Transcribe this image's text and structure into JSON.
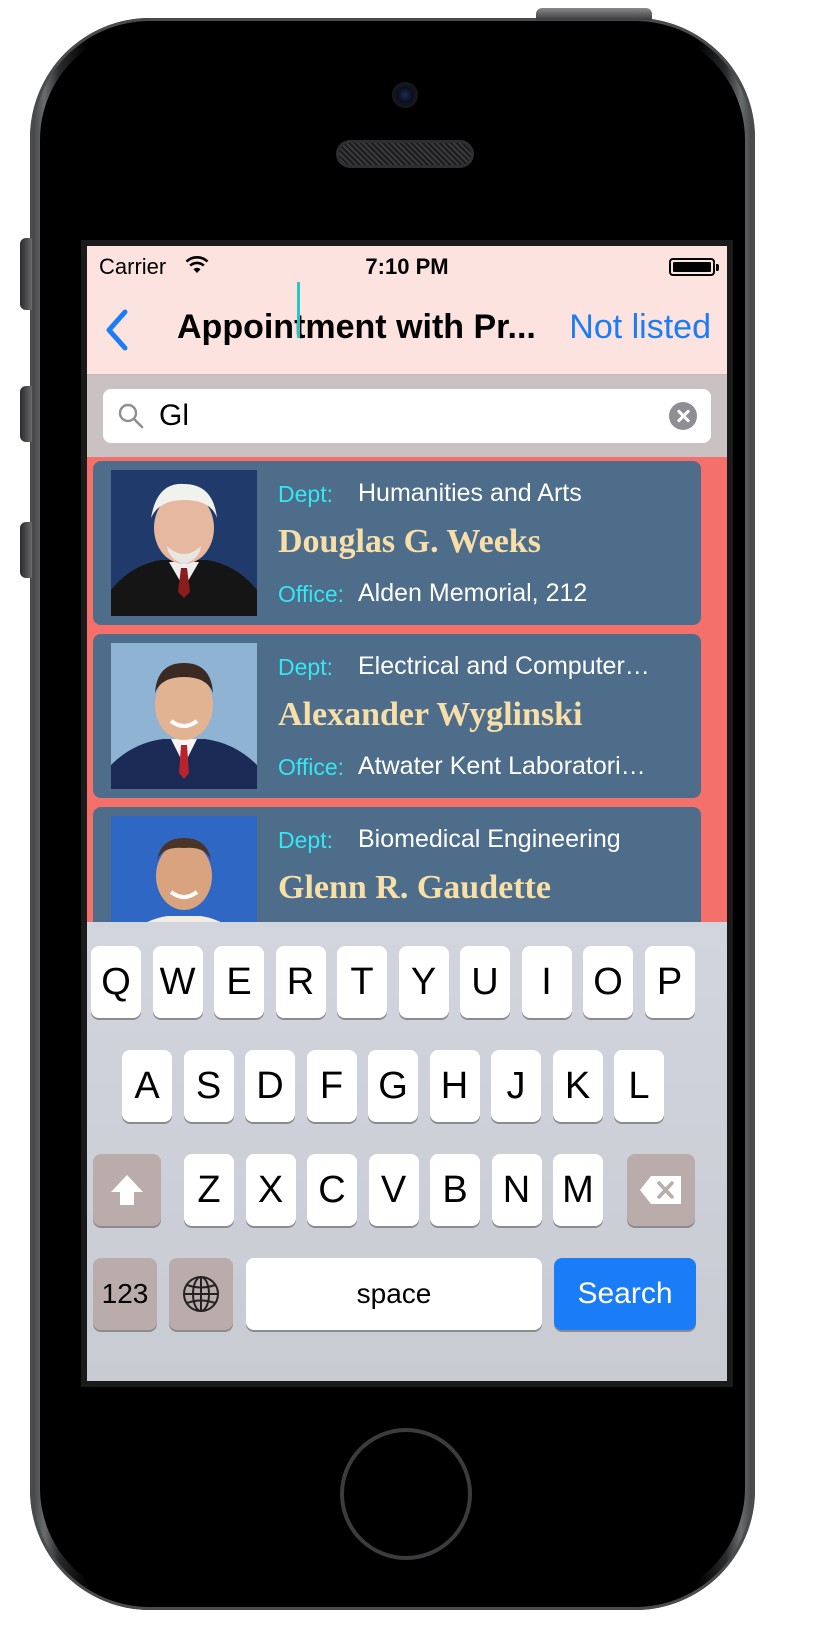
{
  "status_bar": {
    "carrier": "Carrier",
    "time": "7:10 PM"
  },
  "nav": {
    "title": "Appointment with Pr...",
    "right_button": "Not listed"
  },
  "search": {
    "query": "Gl"
  },
  "results": [
    {
      "dept_label": "Dept:",
      "dept": "Humanities and Arts",
      "name": "Douglas G. Weeks",
      "office_label": "Office:",
      "office": "Alden Memorial, 212"
    },
    {
      "dept_label": "Dept:",
      "dept": "Electrical and Computer…",
      "name": "Alexander Wyglinski",
      "office_label": "Office:",
      "office": "Atwater Kent Laboratori…"
    },
    {
      "dept_label": "Dept:",
      "dept": "Biomedical Engineering",
      "name": "Glenn R. Gaudette"
    }
  ],
  "keyboard": {
    "row1": [
      "Q",
      "W",
      "E",
      "R",
      "T",
      "Y",
      "U",
      "I",
      "O",
      "P"
    ],
    "row2": [
      "A",
      "S",
      "D",
      "F",
      "G",
      "H",
      "J",
      "K",
      "L"
    ],
    "row3": [
      "Z",
      "X",
      "C",
      "V",
      "B",
      "N",
      "M"
    ],
    "numbers_key": "123",
    "space_key": "space",
    "search_key": "Search"
  }
}
